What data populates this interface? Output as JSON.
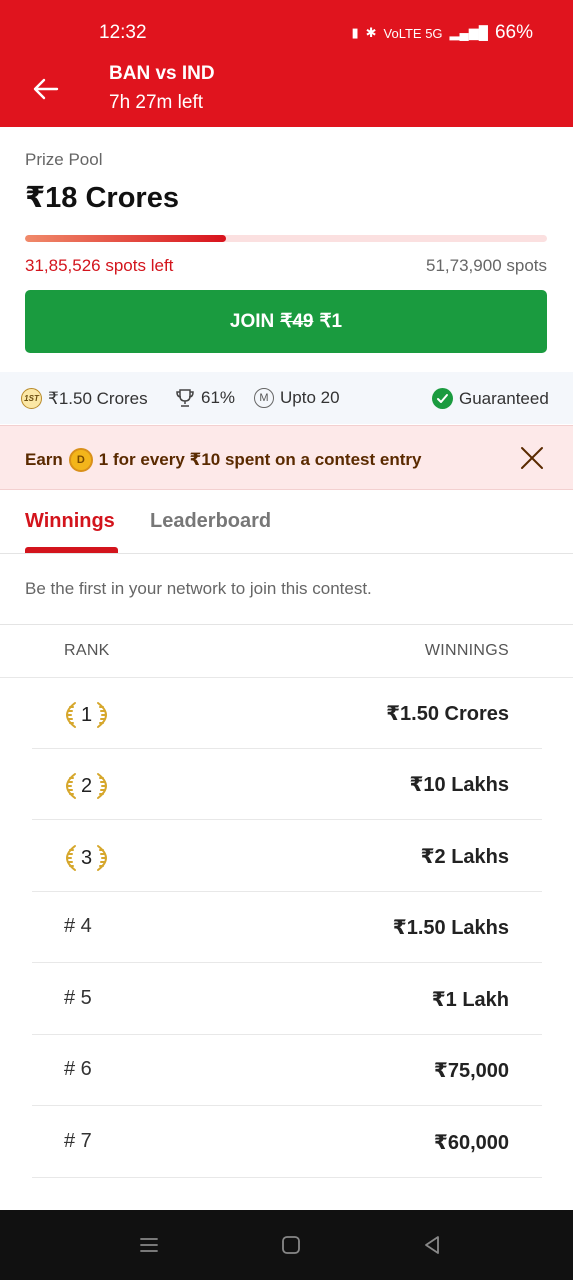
{
  "status_bar": {
    "time": "12:32",
    "battery": "66%",
    "signal_text": "VoLTE 5G"
  },
  "header": {
    "match": "BAN vs IND",
    "time_left": "7h 27m left"
  },
  "prize": {
    "label": "Prize Pool",
    "value": "₹18 Crores",
    "fill_fraction": 0.385,
    "spots_left": "31,85,526 spots left",
    "spots_total": "51,73,900 spots"
  },
  "join": {
    "label": "JOIN",
    "old_price": "₹49",
    "new_price": "₹1"
  },
  "info": {
    "first_prize": "₹1.50 Crores",
    "win_percent": "61%",
    "max_entries": "Upto 20",
    "guaranteed": "Guaranteed",
    "first_badge": "1ST",
    "m_badge": "M"
  },
  "earn": {
    "prefix": "Earn",
    "coin_letter": "D",
    "suffix": "1 for every ₹10 spent on a contest entry"
  },
  "tabs": {
    "winnings": "Winnings",
    "leaderboard": "Leaderboard"
  },
  "network_message": "Be the first in your network to join this contest.",
  "table": {
    "rank_header": "RANK",
    "winnings_header": "WINNINGS",
    "rows": [
      {
        "rank": "1",
        "amount": "₹1.50 Crores"
      },
      {
        "rank": "2",
        "amount": "₹10 Lakhs"
      },
      {
        "rank": "3",
        "amount": "₹2 Lakhs"
      },
      {
        "rank": "# 4",
        "amount": "₹1.50 Lakhs"
      },
      {
        "rank": "# 5",
        "amount": "₹1 Lakh"
      },
      {
        "rank": "# 6",
        "amount": "₹75,000"
      },
      {
        "rank": "# 7",
        "amount": "₹60,000"
      }
    ]
  },
  "colors": {
    "brand_red": "#e0141e",
    "join_green": "#1a9b3f"
  },
  "icons": {
    "back": "arrow-left-icon",
    "trophy": "trophy-icon",
    "check": "check-circle-icon",
    "close": "close-icon",
    "laurel": "laurel-icon"
  }
}
